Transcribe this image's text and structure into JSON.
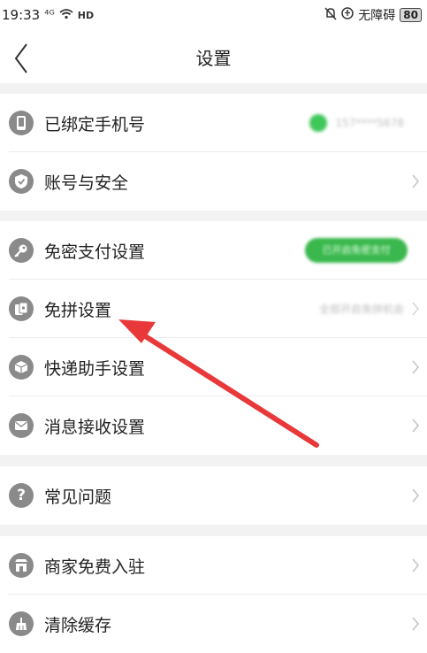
{
  "status_bar": {
    "time": "19:33",
    "signal": "⁴ᴳ",
    "network": "HD",
    "accessibility": "无障碍",
    "battery": "80"
  },
  "header": {
    "title": "设置",
    "back_icon": "chevron-left-icon"
  },
  "groups": [
    {
      "items": [
        {
          "label": "已绑定手机号",
          "icon": "phone-icon",
          "value": "157****5678"
        },
        {
          "label": "账号与安全",
          "icon": "shield-icon"
        }
      ]
    },
    {
      "items": [
        {
          "label": "免密支付设置",
          "icon": "key-icon",
          "value": "已开启免密支付"
        },
        {
          "label": "免拼设置",
          "icon": "cards-icon",
          "value": "全部开启免拼机会"
        },
        {
          "label": "快递助手设置",
          "icon": "package-icon"
        },
        {
          "label": "消息接收设置",
          "icon": "envelope-icon"
        }
      ]
    },
    {
      "items": [
        {
          "label": "常见问题",
          "icon": "question-icon"
        }
      ]
    },
    {
      "items": [
        {
          "label": "商家免费入驻",
          "icon": "store-icon"
        },
        {
          "label": "清除缓存",
          "icon": "broom-icon"
        }
      ]
    }
  ],
  "colors": {
    "accent_green": "#3ab84d",
    "annotation_arrow": "#e8383a",
    "icon_gray": "#8a8a8a",
    "background": "#f2f2f2"
  }
}
